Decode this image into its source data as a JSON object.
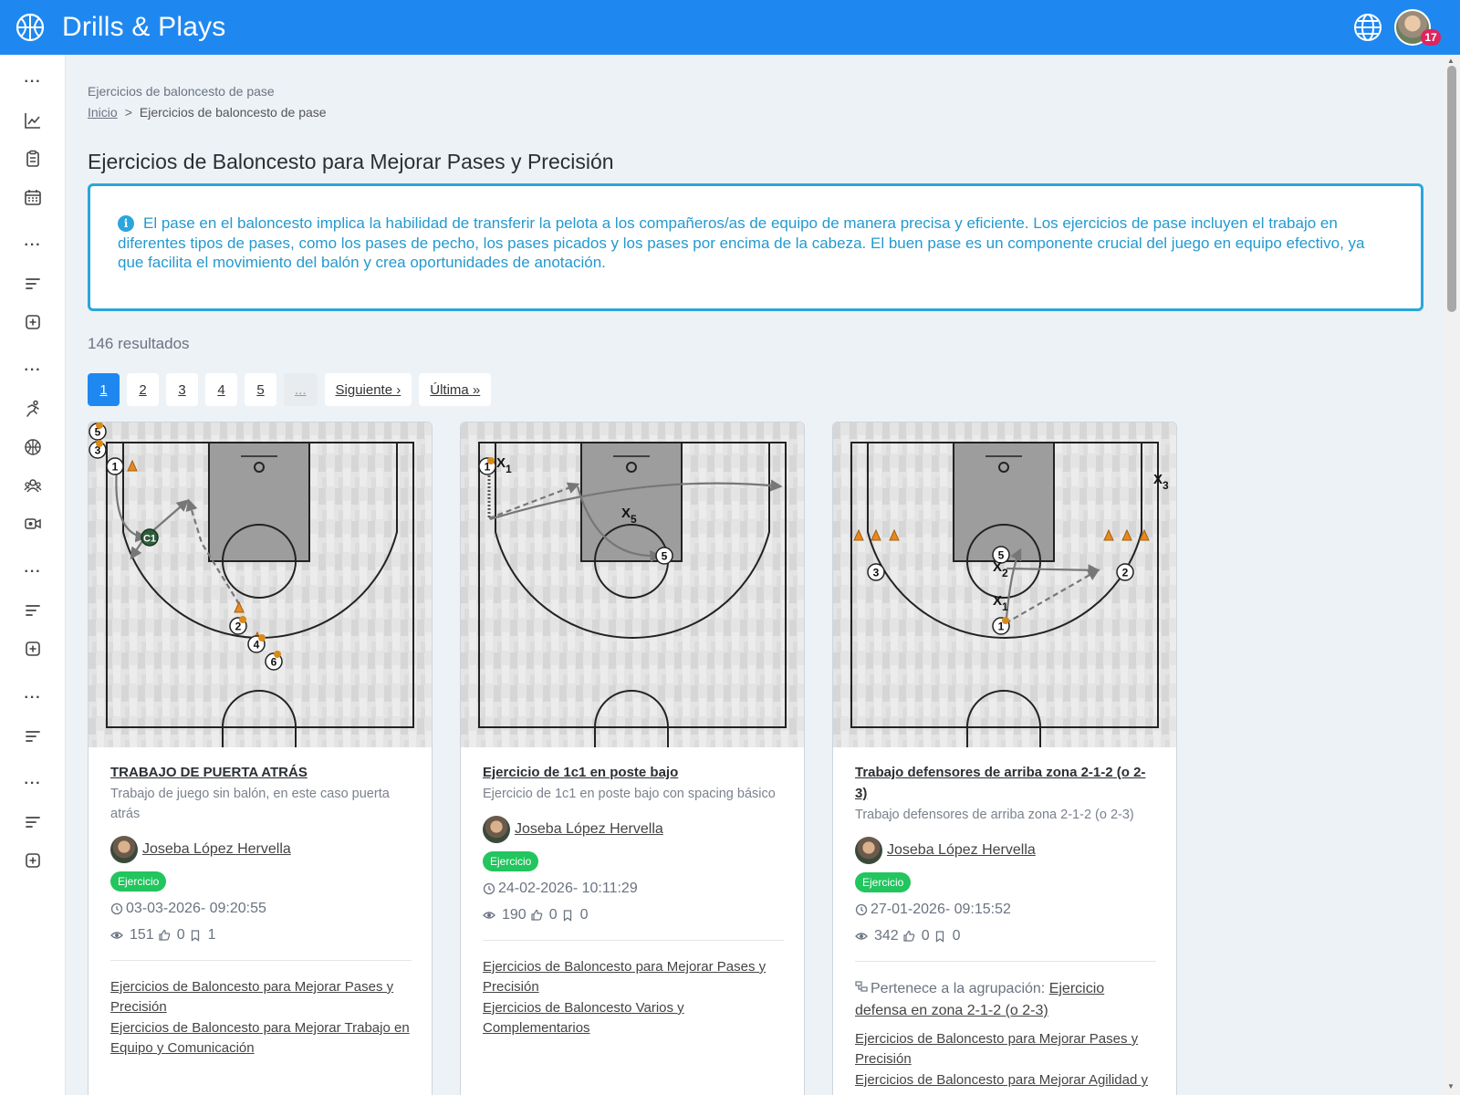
{
  "app": {
    "title": "Drills & Plays",
    "notifications": "17"
  },
  "sidebar": {
    "icons": [
      "more-icon",
      "chart-line-icon",
      "clipboard-icon",
      "calendar-icon",
      "more-icon",
      "sort-icon",
      "plus-square-icon",
      "more-icon",
      "running-icon",
      "basketball-icon",
      "team-icon",
      "video-icon",
      "more-icon",
      "sort-icon",
      "plus-square-icon",
      "more-icon",
      "sort-icon",
      "more-icon",
      "sort-icon",
      "plus-square-icon"
    ]
  },
  "page": {
    "label": "Ejercicios de baloncesto de pase",
    "breadcrumb_home": "Inicio",
    "breadcrumb_sep": ">",
    "breadcrumb_current": "Ejercicios de baloncesto de pase",
    "title": "Ejercicios de Baloncesto para Mejorar Pases y Precisión",
    "info": "El pase en el baloncesto implica la habilidad de transferir la pelota a los compañeros/as de equipo de manera precisa y eficiente. Los ejercicios de pase incluyen el trabajo en diferentes tipos de pases, como los pases de pecho, los pases picados y los pases por encima de la cabeza. El buen pase es un componente crucial del juego en equipo efectivo, ya que facilita el movimiento del balón y crea oportunidades de anotación.",
    "results": "146 resultados"
  },
  "pagination": {
    "pages": [
      "1",
      "2",
      "3",
      "4",
      "5"
    ],
    "ellipsis": "...",
    "next": "Siguiente ›",
    "last": "Última »",
    "active": "1"
  },
  "cards": [
    {
      "title": "TRABAJO DE PUERTA ATRÁS",
      "desc": "Trabajo de juego sin balón, en este caso puerta atrás",
      "author": "Joseba López Hervella",
      "badge": "Ejercicio",
      "date": "03-03-2026- 09:20:55",
      "views": "151",
      "likes": "0",
      "saves": "1",
      "group_label": "",
      "group_link": "",
      "links": [
        "Ejercicios de Baloncesto para Mejorar Pases y Precisión",
        "Ejercicios de Baloncesto para Mejorar Trabajo en Equipo y Comunicación"
      ]
    },
    {
      "title": "Ejercicio de 1c1 en poste bajo",
      "desc": "Ejercicio de 1c1 en poste bajo con spacing básico",
      "author": "Joseba López Hervella",
      "badge": "Ejercicio",
      "date": "24-02-2026- 10:11:29",
      "views": "190",
      "likes": "0",
      "saves": "0",
      "group_label": "",
      "group_link": "",
      "links": [
        "Ejercicios de Baloncesto para Mejorar Pases y Precisión",
        "Ejercicios de Baloncesto Varios y Complementarios"
      ]
    },
    {
      "title": "Trabajo defensores de arriba zona 2-1-2 (o 2-3)",
      "desc": "Trabajo defensores de arriba zona 2-1-2 (o 2-3)",
      "author": "Joseba López Hervella",
      "badge": "Ejercicio",
      "date": "27-01-2026- 09:15:52",
      "views": "342",
      "likes": "0",
      "saves": "0",
      "group_label": "Pertenece a la agrupación:",
      "group_link": "Ejercicio defensa en zona 2-1-2 (o 2-3)",
      "links": [
        "Ejercicios de Baloncesto para Mejorar Pases y Precisión",
        "Ejercicios de Baloncesto para Mejorar Agilidad y"
      ]
    }
  ],
  "diagrams": [
    {
      "players": [
        "5",
        "3",
        "1",
        "2",
        "4",
        "6"
      ],
      "coach": "C1"
    },
    {
      "players": [
        "1",
        "5"
      ],
      "defenders": [
        "X1",
        "X5"
      ]
    },
    {
      "players": [
        "3",
        "5",
        "2",
        "1"
      ],
      "defenders": [
        "X3",
        "X2",
        "X1"
      ]
    }
  ]
}
